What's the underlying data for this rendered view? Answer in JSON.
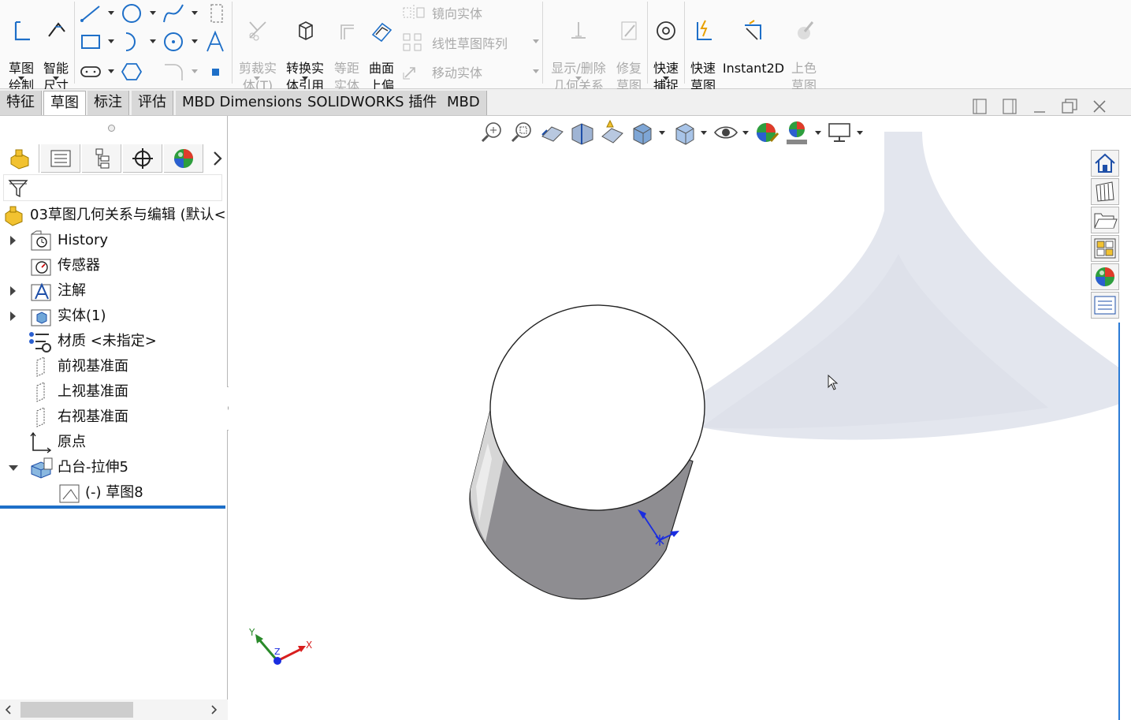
{
  "ribbon": {
    "sketch_draw": "草图\n绘制",
    "smart_dim": "智能\n尺寸",
    "trim_entities": "剪裁实\n体(T)",
    "convert_entities": "转换实\n体引用",
    "offset_entities": "等距\n实体",
    "offset_on_surface": "曲面\n上偏\n移",
    "mirror_entities": "镜向实体",
    "linear_pattern": "线性草图阵列",
    "move_entities": "移动实体",
    "display_relations": "显示/删除\n几何关系",
    "repair_sketch": "修复\n草图",
    "quick_snaps": "快速\n捕捉",
    "rapid_sketch": "快速\n草图",
    "instant2d": "Instant2D",
    "shaded_contours": "上色\n草图\n轮廓"
  },
  "tabs": [
    {
      "label": "特征"
    },
    {
      "label": "草图"
    },
    {
      "label": "标注"
    },
    {
      "label": "评估"
    },
    {
      "label": "MBD Dimensions"
    },
    {
      "label": "SOLIDWORKS 插件"
    },
    {
      "label": "MBD"
    }
  ],
  "active_tab": "草图",
  "tree": {
    "root": "03草图几何关系与编辑  (默认<",
    "items": [
      {
        "label": "History"
      },
      {
        "label": "传感器"
      },
      {
        "label": "注解"
      },
      {
        "label": "实体(1)"
      },
      {
        "label": "材质 <未指定>"
      },
      {
        "label": "前视基准面"
      },
      {
        "label": "上视基准面"
      },
      {
        "label": "右视基准面"
      },
      {
        "label": "原点"
      },
      {
        "label": "凸台-拉伸5"
      },
      {
        "label": "(-) 草图8"
      }
    ]
  },
  "triad": {
    "x": "X",
    "y": "Y",
    "z": "Z"
  },
  "colors": {
    "accent": "#1e6fc8",
    "ribbon_bg": "#fafafa",
    "disabled_text": "#aaaaaa",
    "cylinder_side": "#8e8d91",
    "cylinder_top": "#ffffff",
    "background_shape": "#e3e6ee"
  },
  "icons": [
    "sketch-icon",
    "smart-dimension-icon",
    "line-icon",
    "circle-icon",
    "spline-icon",
    "rectangle-icon",
    "arc-icon",
    "polygon-icon",
    "slot-icon",
    "text-icon",
    "point-icon",
    "fillet-icon",
    "trim-icon",
    "convert-icon",
    "offset-icon",
    "offset-surface-icon",
    "mirror-icon",
    "pattern-icon",
    "move-icon",
    "relations-icon",
    "repair-icon",
    "snap-icon",
    "rapid-sketch-icon",
    "instant2d-icon",
    "shaded-sketch-icon"
  ]
}
